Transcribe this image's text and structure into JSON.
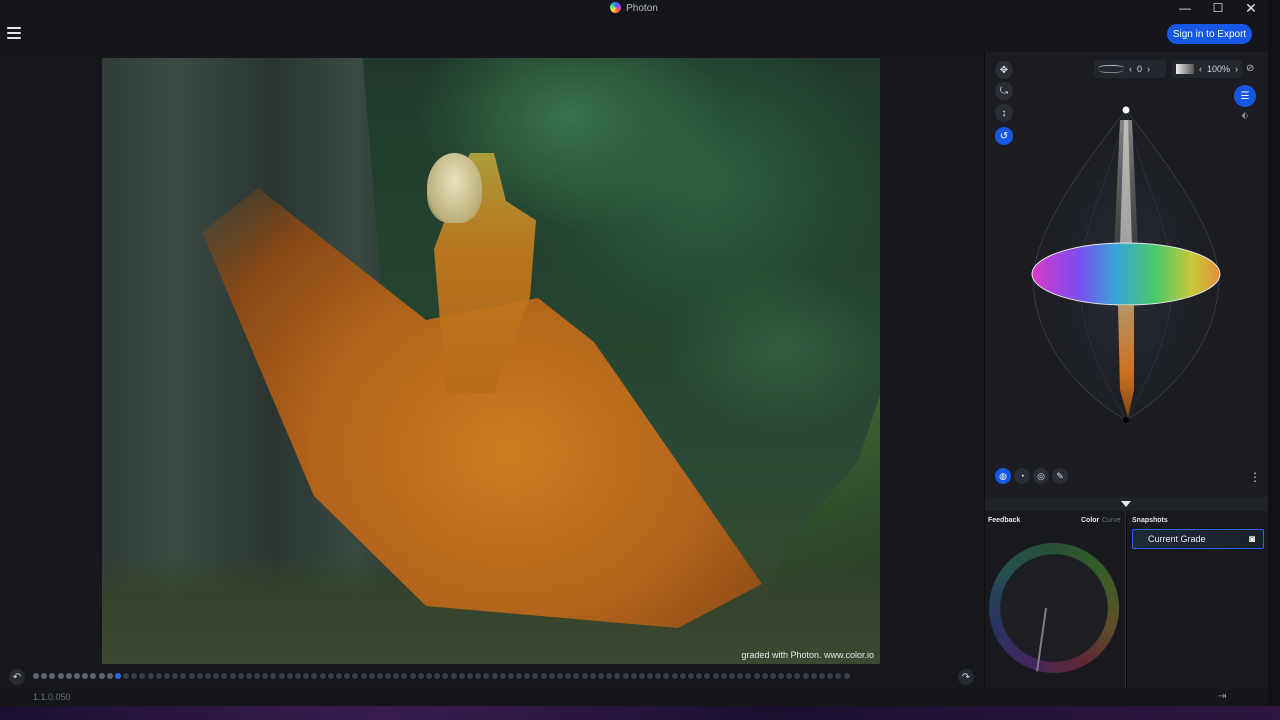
{
  "window": {
    "title": "Photon",
    "controls": {
      "minimize": "—",
      "maximize": "☐",
      "close": "✕"
    }
  },
  "toolbar": {
    "menu_icon": "hamburger-icon",
    "export_label": "Sign in to Export"
  },
  "viewer": {
    "watermark": "graded with Photon. www.color.io"
  },
  "timeline": {
    "total_steps": 100,
    "filled_steps": 10,
    "current_step": 11,
    "undo_icon": "↶",
    "redo_icon": "↷"
  },
  "status": {
    "version": "1.1.0.050",
    "pin_icon": "⇥"
  },
  "scope": {
    "tools": [
      {
        "name": "move-icon",
        "glyph": "✥",
        "active": false
      },
      {
        "name": "rotate-icon",
        "glyph": "⤿",
        "active": false
      },
      {
        "name": "vertical-resize-icon",
        "glyph": "↕",
        "active": false
      },
      {
        "name": "reset-view-icon",
        "glyph": "↺",
        "active": true
      }
    ],
    "smoothing_value": "0",
    "opacity_value": "100%",
    "arrow_left": "‹",
    "arrow_right": "›",
    "eye_icon": "⊘",
    "mode_icon": "☰",
    "mode2_icon": "⬖",
    "tabs": [
      {
        "name": "globe-scope-tab",
        "glyph": "◍",
        "active": true
      },
      {
        "name": "hue-scope-tab",
        "glyph": "◔",
        "active": false
      },
      {
        "name": "target-scope-tab",
        "glyph": "◎",
        "active": false
      },
      {
        "name": "picker-scope-tab",
        "glyph": "✎",
        "active": false
      }
    ],
    "menu_glyph": "⋮"
  },
  "feedback": {
    "title": "Feedback",
    "color_label": "Color",
    "curve_label": "Curve"
  },
  "snapshots": {
    "title": "Snapshots",
    "items": [
      {
        "label": "Current Grade"
      }
    ],
    "camera_glyph": "◙"
  },
  "colors": {
    "accent": "#1757e6",
    "panel": "#1a1c21",
    "background": "#15171c"
  }
}
